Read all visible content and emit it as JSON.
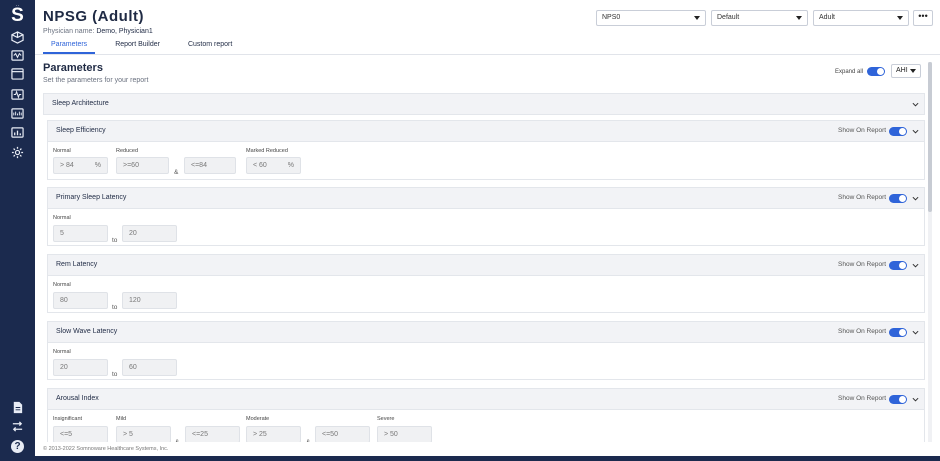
{
  "sidebar": {
    "logo": "S",
    "top_icons": [
      "cube-icon",
      "dna-icon",
      "calendar-icon",
      "monitor-icon",
      "signal-icon",
      "chart-icon",
      "gear-icon"
    ],
    "bottom_icons": [
      "document-icon",
      "transfer-icon",
      "help-icon"
    ],
    "help_glyph": "?"
  },
  "header": {
    "title": "NPSG (Adult)",
    "physician_label": "Physician name:",
    "physician_name": "Demo, Physician1",
    "tabs": [
      {
        "label": "Parameters",
        "active": true
      },
      {
        "label": "Report Builder",
        "active": false
      },
      {
        "label": "Custom report",
        "active": false
      }
    ],
    "dropdowns": {
      "study": "NPS0",
      "template": "Default",
      "population": "Adult"
    },
    "more_label": "•••"
  },
  "parameters": {
    "title": "Parameters",
    "subtitle": "Set the parameters for your report",
    "expand_all_label": "Expand all",
    "expand_all_on": true,
    "index_select": "AHI",
    "group_label": "Sleep Architecture"
  },
  "cards": [
    {
      "title": "Sleep Efficiency",
      "show_on_report_label": "Show On Report",
      "fields": [
        {
          "label": "Normal",
          "value": ">  84",
          "unit": "%"
        },
        {
          "label": "Reduced",
          "value": ">=60",
          "connector": "&",
          "value2": "<=84"
        },
        {
          "label": "Marked Reduced",
          "value": "<  60",
          "unit": "%"
        }
      ]
    },
    {
      "title": "Primary Sleep Latency",
      "show_on_report_label": "Show On Report",
      "fields": [
        {
          "label": "Normal",
          "value": "5",
          "connector": "to",
          "value2": "20"
        }
      ]
    },
    {
      "title": "Rem Latency",
      "show_on_report_label": "Show On Report",
      "fields": [
        {
          "label": "Normal",
          "value": "80",
          "connector": "to",
          "value2": "120"
        }
      ]
    },
    {
      "title": "Slow Wave Latency",
      "show_on_report_label": "Show On Report",
      "fields": [
        {
          "label": "Normal",
          "value": "20",
          "connector": "to",
          "value2": "60"
        }
      ]
    },
    {
      "title": "Arousal Index",
      "show_on_report_label": "Show On Report",
      "fields": [
        {
          "label": "Insignificant",
          "value": "<=5"
        },
        {
          "label": "Mild",
          "value": ">  5",
          "connector": "&",
          "value2": "<=25"
        },
        {
          "label": "Moderate",
          "value": ">  25",
          "connector": "&",
          "value2": "<=50"
        },
        {
          "label": "Severe",
          "value": ">  50"
        }
      ]
    }
  ],
  "footer": {
    "copyright": "© 2013-2022 Somnoware Healthcare Systems, Inc."
  },
  "colors": {
    "sidebar": "#1b2a4e",
    "accent": "#2f64d9",
    "card_header": "#f2f3f6"
  }
}
